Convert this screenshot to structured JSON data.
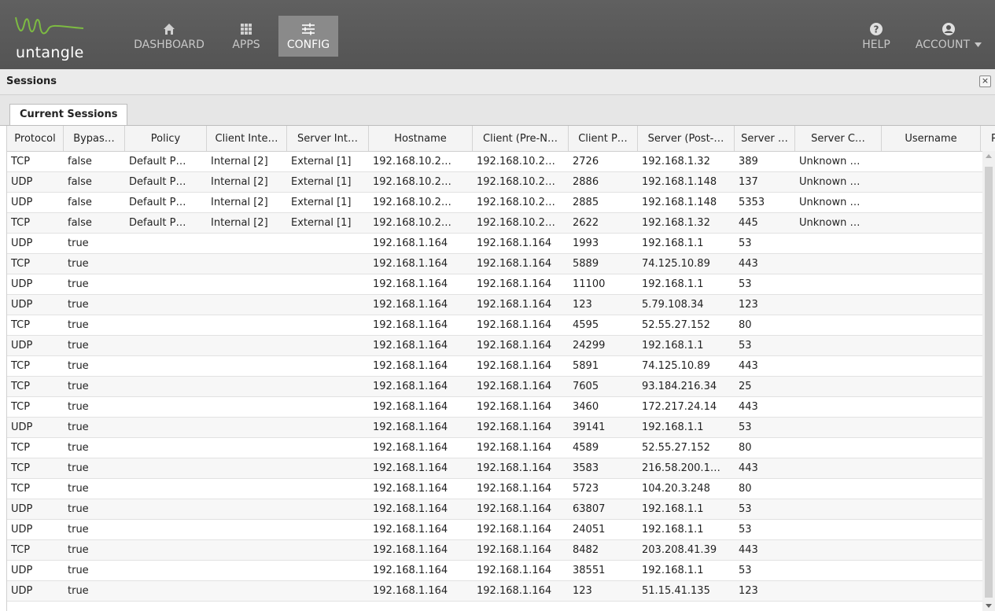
{
  "brand": {
    "name": "untangle",
    "color": "#7dbb42"
  },
  "nav": {
    "dashboard": "DASHBOARD",
    "apps": "APPS",
    "config": "CONFIG",
    "help": "HELP",
    "account": "ACCOUNT"
  },
  "panel": {
    "title": "Sessions",
    "close": "×"
  },
  "tabs": [
    {
      "label": "Current Sessions",
      "active": true
    }
  ],
  "columns": [
    "Protocol",
    "Bypas…",
    "Policy",
    "Client Inte…",
    "Server Int…",
    "Hostname",
    "Client (Pre-N…",
    "Client P…",
    "Server (Post-…",
    "Server …",
    "Server C…",
    "Username",
    "Pr"
  ],
  "rows": [
    [
      "TCP",
      "false",
      "Default P…",
      "Internal [2]",
      "External [1]",
      "192.168.10.2…",
      "192.168.10.2…",
      "2726",
      "192.168.1.32",
      "389",
      "Unknown …",
      ""
    ],
    [
      "UDP",
      "false",
      "Default P…",
      "Internal [2]",
      "External [1]",
      "192.168.10.2…",
      "192.168.10.2…",
      "2886",
      "192.168.1.148",
      "137",
      "Unknown …",
      ""
    ],
    [
      "UDP",
      "false",
      "Default P…",
      "Internal [2]",
      "External [1]",
      "192.168.10.2…",
      "192.168.10.2…",
      "2885",
      "192.168.1.148",
      "5353",
      "Unknown …",
      ""
    ],
    [
      "TCP",
      "false",
      "Default P…",
      "Internal [2]",
      "External [1]",
      "192.168.10.2…",
      "192.168.10.2…",
      "2622",
      "192.168.1.32",
      "445",
      "Unknown …",
      ""
    ],
    [
      "UDP",
      "true",
      "",
      "",
      "",
      "192.168.1.164",
      "192.168.1.164",
      "1993",
      "192.168.1.1",
      "53",
      "",
      ""
    ],
    [
      "TCP",
      "true",
      "",
      "",
      "",
      "192.168.1.164",
      "192.168.1.164",
      "5889",
      "74.125.10.89",
      "443",
      "",
      ""
    ],
    [
      "UDP",
      "true",
      "",
      "",
      "",
      "192.168.1.164",
      "192.168.1.164",
      "11100",
      "192.168.1.1",
      "53",
      "",
      ""
    ],
    [
      "UDP",
      "true",
      "",
      "",
      "",
      "192.168.1.164",
      "192.168.1.164",
      "123",
      "5.79.108.34",
      "123",
      "",
      ""
    ],
    [
      "TCP",
      "true",
      "",
      "",
      "",
      "192.168.1.164",
      "192.168.1.164",
      "4595",
      "52.55.27.152",
      "80",
      "",
      ""
    ],
    [
      "UDP",
      "true",
      "",
      "",
      "",
      "192.168.1.164",
      "192.168.1.164",
      "24299",
      "192.168.1.1",
      "53",
      "",
      ""
    ],
    [
      "TCP",
      "true",
      "",
      "",
      "",
      "192.168.1.164",
      "192.168.1.164",
      "5891",
      "74.125.10.89",
      "443",
      "",
      ""
    ],
    [
      "TCP",
      "true",
      "",
      "",
      "",
      "192.168.1.164",
      "192.168.1.164",
      "7605",
      "93.184.216.34",
      "25",
      "",
      ""
    ],
    [
      "TCP",
      "true",
      "",
      "",
      "",
      "192.168.1.164",
      "192.168.1.164",
      "3460",
      "172.217.24.14",
      "443",
      "",
      ""
    ],
    [
      "UDP",
      "true",
      "",
      "",
      "",
      "192.168.1.164",
      "192.168.1.164",
      "39141",
      "192.168.1.1",
      "53",
      "",
      ""
    ],
    [
      "TCP",
      "true",
      "",
      "",
      "",
      "192.168.1.164",
      "192.168.1.164",
      "4589",
      "52.55.27.152",
      "80",
      "",
      ""
    ],
    [
      "TCP",
      "true",
      "",
      "",
      "",
      "192.168.1.164",
      "192.168.1.164",
      "3583",
      "216.58.200.1…",
      "443",
      "",
      ""
    ],
    [
      "TCP",
      "true",
      "",
      "",
      "",
      "192.168.1.164",
      "192.168.1.164",
      "5723",
      "104.20.3.248",
      "80",
      "",
      ""
    ],
    [
      "UDP",
      "true",
      "",
      "",
      "",
      "192.168.1.164",
      "192.168.1.164",
      "63807",
      "192.168.1.1",
      "53",
      "",
      ""
    ],
    [
      "UDP",
      "true",
      "",
      "",
      "",
      "192.168.1.164",
      "192.168.1.164",
      "24051",
      "192.168.1.1",
      "53",
      "",
      ""
    ],
    [
      "TCP",
      "true",
      "",
      "",
      "",
      "192.168.1.164",
      "192.168.1.164",
      "8482",
      "203.208.41.39",
      "443",
      "",
      ""
    ],
    [
      "UDP",
      "true",
      "",
      "",
      "",
      "192.168.1.164",
      "192.168.1.164",
      "38551",
      "192.168.1.1",
      "53",
      "",
      ""
    ],
    [
      "UDP",
      "true",
      "",
      "",
      "",
      "192.168.1.164",
      "192.168.1.164",
      "123",
      "51.15.41.135",
      "123",
      "",
      ""
    ]
  ]
}
